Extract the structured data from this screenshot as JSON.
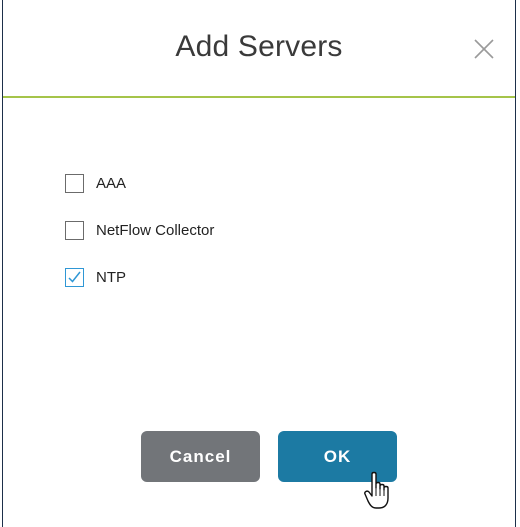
{
  "dialog": {
    "title": "Add Servers",
    "accent_color": "#a5c44a"
  },
  "options": [
    {
      "label": "AAA",
      "checked": false
    },
    {
      "label": "NetFlow Collector",
      "checked": false
    },
    {
      "label": "NTP",
      "checked": true
    }
  ],
  "buttons": {
    "cancel_label": "Cancel",
    "ok_label": "OK",
    "cancel_color": "#727579",
    "ok_color": "#1c7aa3"
  },
  "icons": {
    "close": "close-icon",
    "check": "checkmark-icon",
    "cursor": "hand-pointer-icon"
  }
}
